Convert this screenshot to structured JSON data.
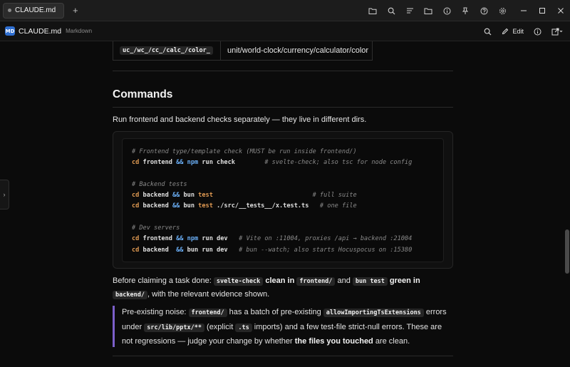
{
  "titlebar": {
    "tab_label": "CLAUDE.md",
    "add_tab": "+"
  },
  "docbar": {
    "badge": "MD",
    "title": "CLAUDE.md",
    "kind": "Markdown",
    "edit_label": "Edit"
  },
  "table_row": {
    "code": "uc_/wc_/cc_/calc_/color_",
    "text": "unit/world-clock/currency/calculator/color"
  },
  "section": {
    "heading": "Commands",
    "intro": "Run frontend and backend checks separately — they live in different dirs."
  },
  "code_block": {
    "lines": [
      [
        {
          "t": "# Frontend type/template check (MUST be run inside frontend/)",
          "k": "com"
        }
      ],
      [
        {
          "t": "cd",
          "k": "cmd"
        },
        {
          "t": " frontend ",
          "k": "arg"
        },
        {
          "t": "&&",
          "k": "op"
        },
        {
          "t": " ",
          "k": "arg"
        },
        {
          "t": "npm",
          "k": "npm"
        },
        {
          "t": " run check        ",
          "k": "arg"
        },
        {
          "t": "# svelte-check; also tsc for node config",
          "k": "com"
        }
      ],
      [],
      [
        {
          "t": "# Backend tests",
          "k": "com"
        }
      ],
      [
        {
          "t": "cd",
          "k": "cmd"
        },
        {
          "t": " backend ",
          "k": "arg"
        },
        {
          "t": "&&",
          "k": "op"
        },
        {
          "t": " bun ",
          "k": "arg"
        },
        {
          "t": "test",
          "k": "cmd"
        },
        {
          "t": "                           ",
          "k": "arg"
        },
        {
          "t": "# full suite",
          "k": "com"
        }
      ],
      [
        {
          "t": "cd",
          "k": "cmd"
        },
        {
          "t": " backend ",
          "k": "arg"
        },
        {
          "t": "&&",
          "k": "op"
        },
        {
          "t": " bun ",
          "k": "arg"
        },
        {
          "t": "test",
          "k": "cmd"
        },
        {
          "t": " ./src/__tests__/x.test.ts   ",
          "k": "arg"
        },
        {
          "t": "# one file",
          "k": "com"
        }
      ],
      [],
      [
        {
          "t": "# Dev servers",
          "k": "com"
        }
      ],
      [
        {
          "t": "cd",
          "k": "cmd"
        },
        {
          "t": " frontend ",
          "k": "arg"
        },
        {
          "t": "&&",
          "k": "op"
        },
        {
          "t": " ",
          "k": "arg"
        },
        {
          "t": "npm",
          "k": "npm"
        },
        {
          "t": " run dev   ",
          "k": "arg"
        },
        {
          "t": "# Vite on :11004, proxies /api → backend :21004",
          "k": "com"
        }
      ],
      [
        {
          "t": "cd",
          "k": "cmd"
        },
        {
          "t": " backend  ",
          "k": "arg"
        },
        {
          "t": "&&",
          "k": "op"
        },
        {
          "t": " bun run dev   ",
          "k": "arg"
        },
        {
          "t": "# bun --watch; also starts Hocuspocus on :15380",
          "k": "com"
        }
      ]
    ]
  },
  "task_done": {
    "p1": "Before claiming a task done: ",
    "c1": "svelte-check",
    "b1": " clean in ",
    "c2": "frontend/",
    "p2": " and ",
    "c3": "bun test",
    "b2": " green in ",
    "c4": "backend/",
    "p3": ", with the relevant evidence shown."
  },
  "note": {
    "p1": "Pre-existing noise: ",
    "c1": "frontend/",
    "p2": " has a batch of pre-existing ",
    "c2": "allowImportingTsExtensions",
    "p3": " errors under ",
    "c3": "src/lib/pptx/**",
    "p4": " (explicit ",
    "c4": ".ts",
    "p5": " imports) and a few test-file strict-null errors. These are not regressions — judge your change by whether ",
    "b1": "the files you touched",
    "p6": " are clean."
  },
  "colors": {
    "accent_quote": "#7b5fc9",
    "md_badge": "#2f6fd1",
    "code_command": "#e09a52",
    "code_keyword": "#6aaef5"
  }
}
